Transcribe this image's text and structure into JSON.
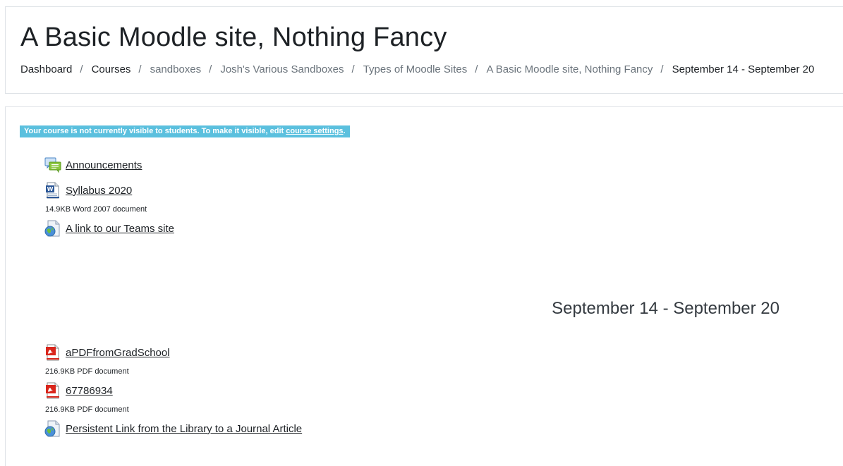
{
  "header": {
    "title": "A Basic Moodle site, Nothing Fancy",
    "breadcrumbs": [
      "Dashboard",
      "Courses",
      "sandboxes",
      "Josh's Various Sandboxes",
      "Types of Moodle Sites",
      "A Basic Moodle site, Nothing Fancy",
      "September 14 - September 20"
    ],
    "separator": "/"
  },
  "notice": {
    "text": "Your course is not currently visible to students. To make it visible, edit ",
    "link": "course settings",
    "end": "."
  },
  "general_section": {
    "activities": [
      {
        "name": "Announcements",
        "icon": "forum-icon"
      },
      {
        "name": "Syllabus 2020",
        "icon": "word-document-icon",
        "info": "14.9KB Word 2007 document"
      },
      {
        "name": "A link to our Teams site",
        "icon": "url-link-icon"
      }
    ]
  },
  "week_section": {
    "title": "September 14 - September 20",
    "activities": [
      {
        "name": "aPDFfromGradSchool",
        "icon": "pdf-icon",
        "info": "216.9KB PDF document"
      },
      {
        "name": "67786934",
        "icon": "pdf-icon",
        "info": "216.9KB PDF document"
      },
      {
        "name": "Persistent Link from the Library to a Journal Article",
        "icon": "url-link-icon"
      }
    ]
  },
  "colors": {
    "notice_bg": "#5bc0de",
    "text": "#1d2125",
    "muted": "#6a737b",
    "border": "#dee2e6"
  }
}
